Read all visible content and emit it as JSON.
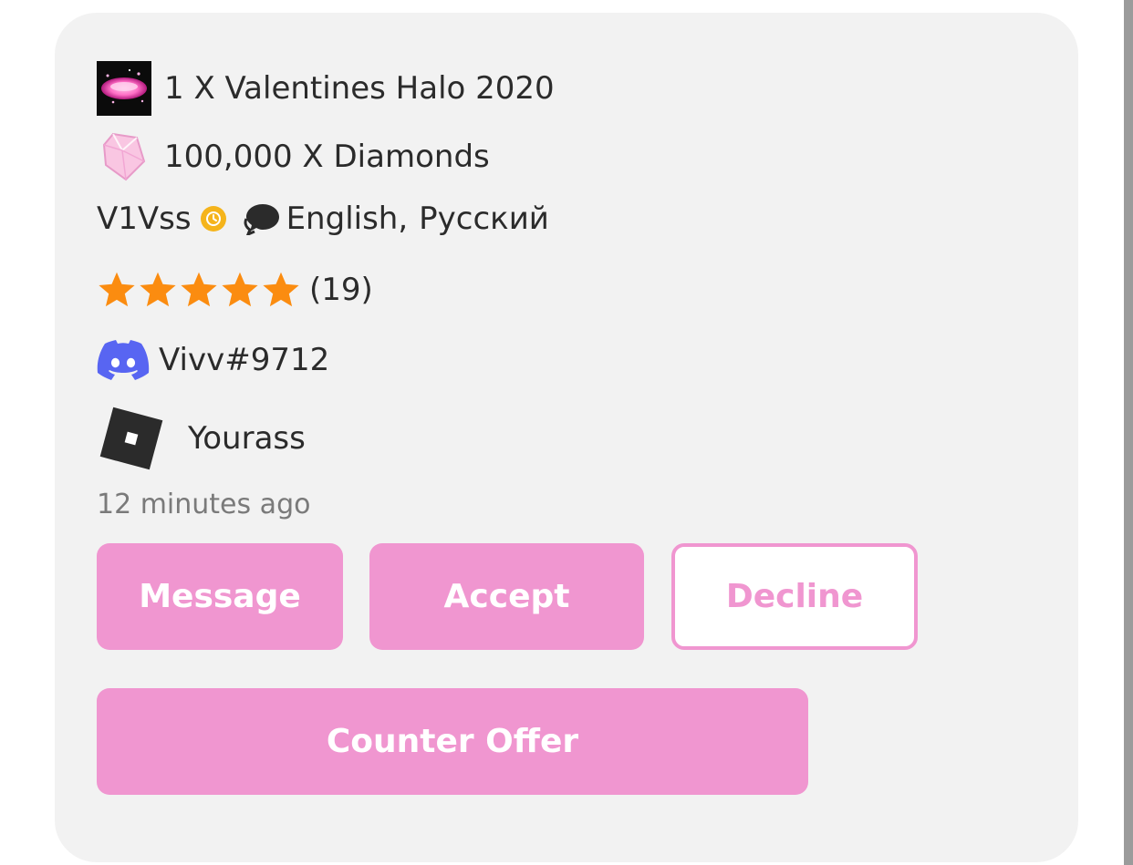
{
  "offer": {
    "items": [
      {
        "icon": "valentines-halo-thumbnail",
        "label": "1 X Valentines Halo 2020"
      },
      {
        "icon": "pink-diamond-icon",
        "label": "100,000 X Diamonds"
      }
    ]
  },
  "trader": {
    "username": "V1Vss",
    "status_icon": "clock-icon",
    "status_color": "#f5b41b",
    "languages_primary": "English,",
    "languages_secondary": "Русский",
    "rating_stars": 5,
    "rating_max": 5,
    "rating_count": "(19)",
    "discord": "Vivv#9712",
    "roblox": "Yourass"
  },
  "timestamp": "12 minutes ago",
  "actions": {
    "message": "Message",
    "accept": "Accept",
    "decline": "Decline",
    "counter_offer": "Counter Offer"
  },
  "colors": {
    "accent": "#f096d0",
    "card_bg": "#f2f2f2",
    "star": "#fb8c10",
    "discord": "#5865f2",
    "text": "#2b2b2b",
    "muted_text": "#7a7a7a"
  }
}
